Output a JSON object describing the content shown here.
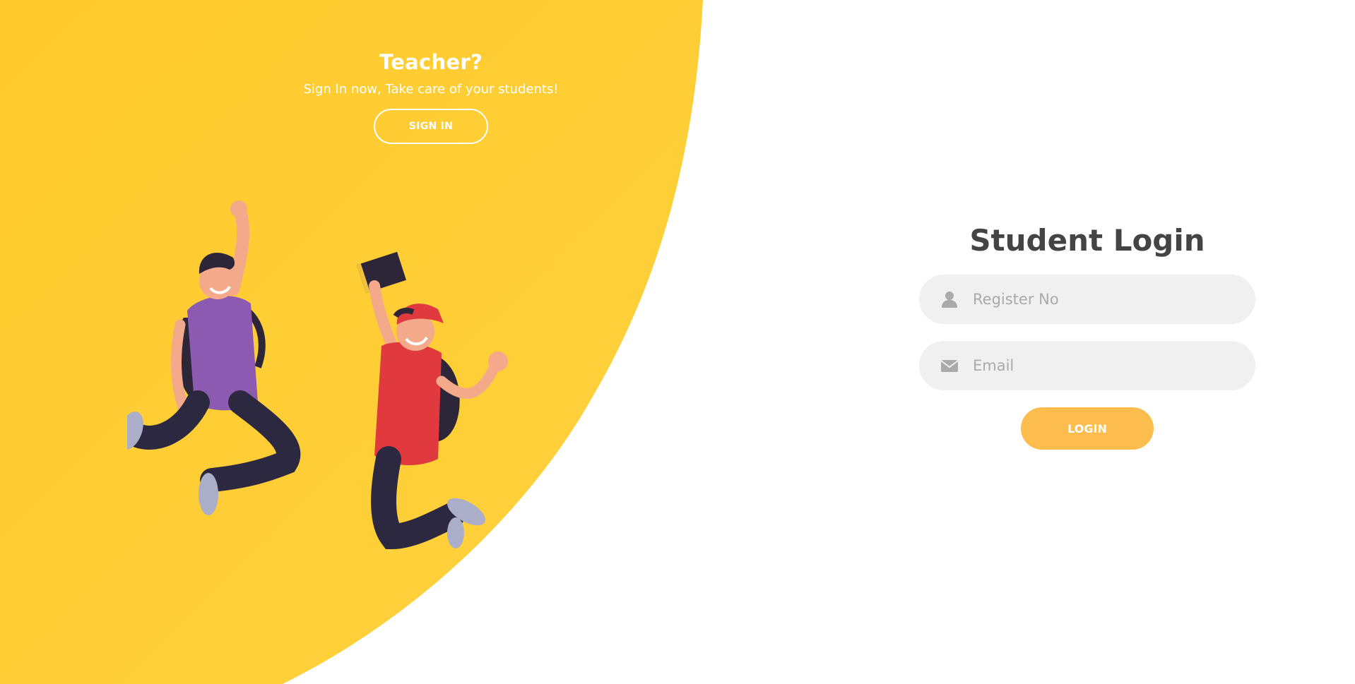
{
  "teacher_panel": {
    "title": "Teacher?",
    "subtitle": "Sign In now, Take care of your students!",
    "signin_label": "SIGN IN"
  },
  "login_form": {
    "title": "Student Login",
    "register_placeholder": "Register No",
    "email_placeholder": "Email",
    "login_label": "LOGIN"
  },
  "icons": {
    "register": "user-icon",
    "email": "envelope-icon"
  },
  "colors": {
    "panel_yellow": "#ffcf33",
    "login_button": "#fcbc4e",
    "input_background": "#f0f0f0",
    "title_text": "#444444"
  }
}
